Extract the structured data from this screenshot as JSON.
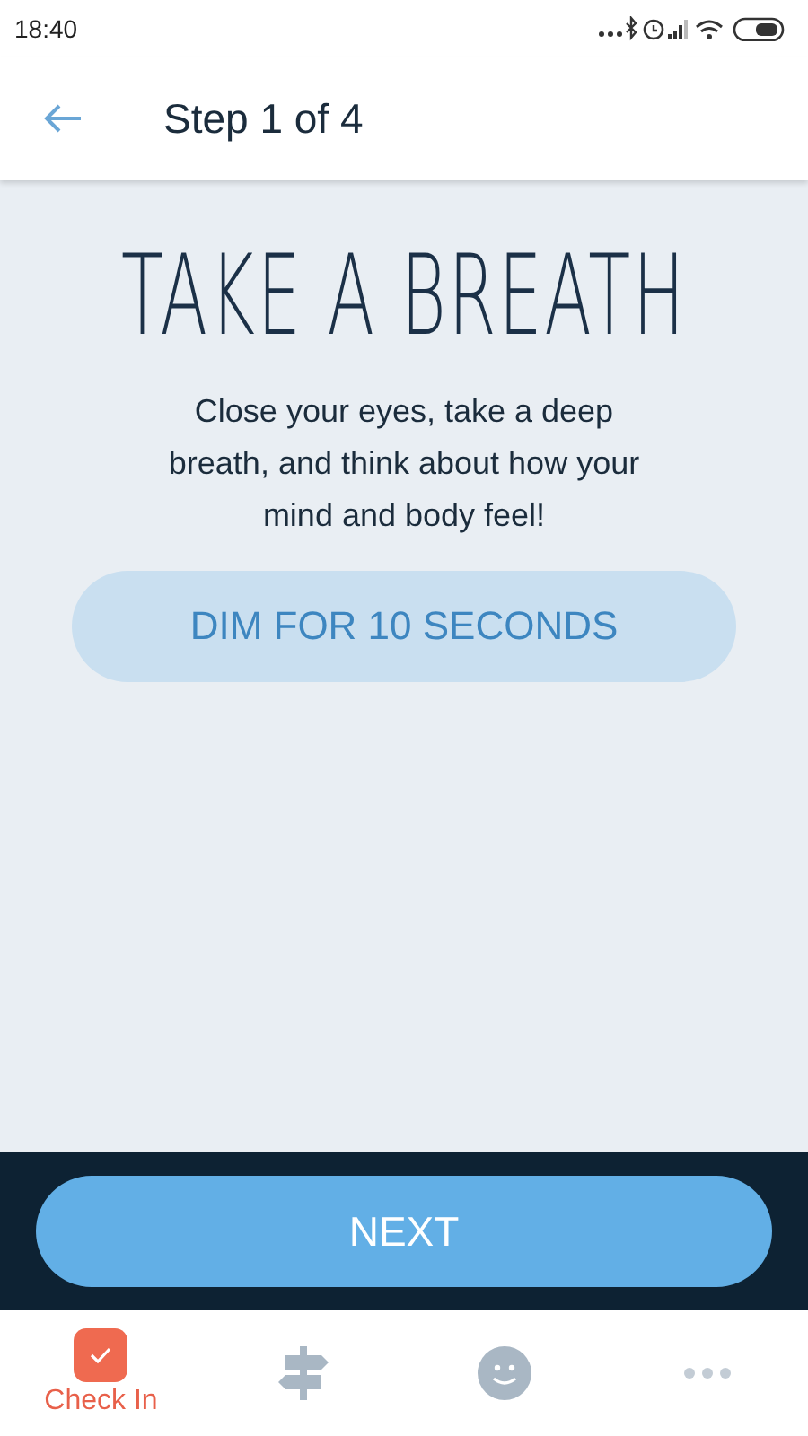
{
  "status_bar": {
    "time": "18:40"
  },
  "header": {
    "title": "Step 1 of 4"
  },
  "content": {
    "heading": "TAKE A BREATH",
    "body": "Close your eyes, take a deep breath, and think about how your mind and body feel!",
    "dim_button": "DIM FOR 10 SECONDS"
  },
  "next_button": "NEXT",
  "tabs": [
    {
      "kind": "checkin",
      "label": "Check In",
      "selected": true
    },
    {
      "kind": "signpost",
      "selected": false
    },
    {
      "kind": "smiley",
      "selected": false
    },
    {
      "kind": "more",
      "selected": false
    }
  ]
}
